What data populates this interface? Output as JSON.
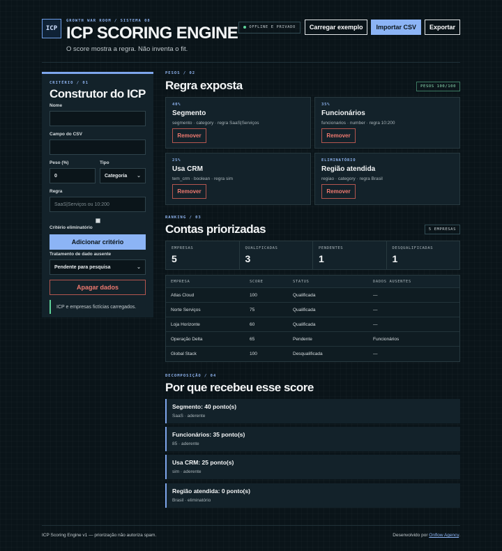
{
  "header": {
    "logo": "ICP",
    "eyebrow": "GROWTH WAR ROOM / SISTEMA 08",
    "title": "ICP SCORING ENGINE",
    "subtitle": "O score mostra a regra. Não inventa o fit.",
    "offline_chip": "OFFLINE E PRIVADO",
    "btn_example": "Carregar exemplo",
    "btn_import": "Importar CSV",
    "btn_export": "Exportar"
  },
  "sidebar": {
    "eyebrow": "CRITÉRIO / 01",
    "title": "Construtor do ICP",
    "name_label": "Nome",
    "name_value": "",
    "csv_field_label": "Campo do CSV",
    "csv_field_value": "",
    "weight_label": "Peso (%)",
    "weight_value": "0",
    "type_label": "Tipo",
    "type_value": "Categoria",
    "rule_label": "Regra",
    "rule_placeholder": "SaaS|Serviços ou 10:200",
    "eliminatory_label": "Critério eliminatório",
    "add_button": "Adicionar critério",
    "missing_label": "Tratamento de dado ausente",
    "missing_value": "Pendente para pesquisa",
    "clear_button": "Apagar dados",
    "status_message": "ICP e empresas fictícias carregados."
  },
  "weights": {
    "eyebrow": "PESOS / 02",
    "title": "Regra exposta",
    "badge": "PESOS 100/100",
    "cards": [
      {
        "tag": "40%",
        "name": "Segmento",
        "meta": "segmento · category · regra SaaS|Serviços",
        "remove": "Remover"
      },
      {
        "tag": "35%",
        "name": "Funcionários",
        "meta": "funcionarios · number · regra 10:200",
        "remove": "Remover"
      },
      {
        "tag": "25%",
        "name": "Usa CRM",
        "meta": "tem_crm · boolean · regra sim",
        "remove": "Remover"
      },
      {
        "tag": "ELIMINATÓRIO",
        "name": "Região atendida",
        "meta": "regiao · category · regra Brasil",
        "remove": "Remover"
      }
    ]
  },
  "ranking": {
    "eyebrow": "RANKING / 03",
    "title": "Contas priorizadas",
    "badge": "5 EMPRESAS",
    "stats": [
      {
        "label": "EMPRESAS",
        "value": "5"
      },
      {
        "label": "QUALIFICADAS",
        "value": "3"
      },
      {
        "label": "PENDENTES",
        "value": "1"
      },
      {
        "label": "DESQUALIFICADAS",
        "value": "1"
      }
    ],
    "columns": [
      "EMPRESA",
      "SCORE",
      "STATUS",
      "DADOS AUSENTES"
    ],
    "rows": [
      {
        "empresa": "Atlas Cloud",
        "score": "100",
        "status": "Qualificada",
        "ausentes": "—"
      },
      {
        "empresa": "Norte Serviços",
        "score": "75",
        "status": "Qualificada",
        "ausentes": "—"
      },
      {
        "empresa": "Loja Horizonte",
        "score": "60",
        "status": "Qualificada",
        "ausentes": "—"
      },
      {
        "empresa": "Operação Delta",
        "score": "65",
        "status": "Pendente",
        "ausentes": "Funcionários"
      },
      {
        "empresa": "Global Stack",
        "score": "100",
        "status": "Desqualificada",
        "ausentes": "—"
      }
    ]
  },
  "decomposition": {
    "eyebrow": "DECOMPOSIÇÃO / 04",
    "title": "Por que recebeu esse score",
    "items": [
      {
        "title": "Segmento: 40 ponto(s)",
        "detail": "SaaS · aderente"
      },
      {
        "title": "Funcionários: 35 ponto(s)",
        "detail": "85 · aderente"
      },
      {
        "title": "Usa CRM: 25 ponto(s)",
        "detail": "sim · aderente"
      },
      {
        "title": "Região atendida: 0 ponto(s)",
        "detail": "Brasil · eliminatório"
      }
    ]
  },
  "footer": {
    "left": "ICP Scoring Engine v1 — priorização não autoriza spam.",
    "right_prefix": "Desenvolvido por ",
    "link": "Onflow Agency",
    "right_suffix": "."
  },
  "colors": {
    "background": "#0a1419",
    "panel": "#13222a",
    "accent": "#8cb4f5",
    "danger": "#f07a70",
    "success": "#5fd39a"
  }
}
